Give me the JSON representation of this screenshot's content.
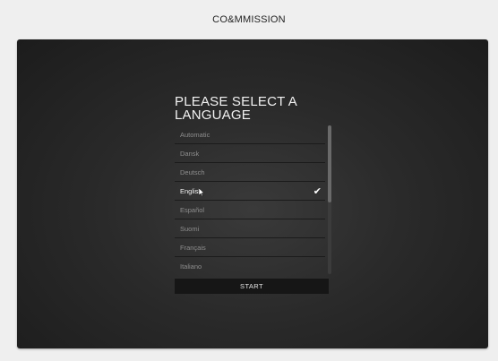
{
  "app": {
    "brand": "CO&MMISSION"
  },
  "dialog": {
    "title_line1": "PLEASE SELECT A",
    "title_line2": "LANGUAGE",
    "start_label": "START",
    "selected_index": 3,
    "scroll_position": 0.0,
    "scroll_visible_fraction": 0.52
  },
  "languages": [
    {
      "label": "Automatic"
    },
    {
      "label": "Dansk"
    },
    {
      "label": "Deutsch"
    },
    {
      "label": "English"
    },
    {
      "label": "Español"
    },
    {
      "label": "Suomi"
    },
    {
      "label": "Français"
    },
    {
      "label": "Italiano"
    }
  ],
  "icons": {
    "check": "checkmark-icon",
    "cursor": "mouse-pointer-icon"
  }
}
